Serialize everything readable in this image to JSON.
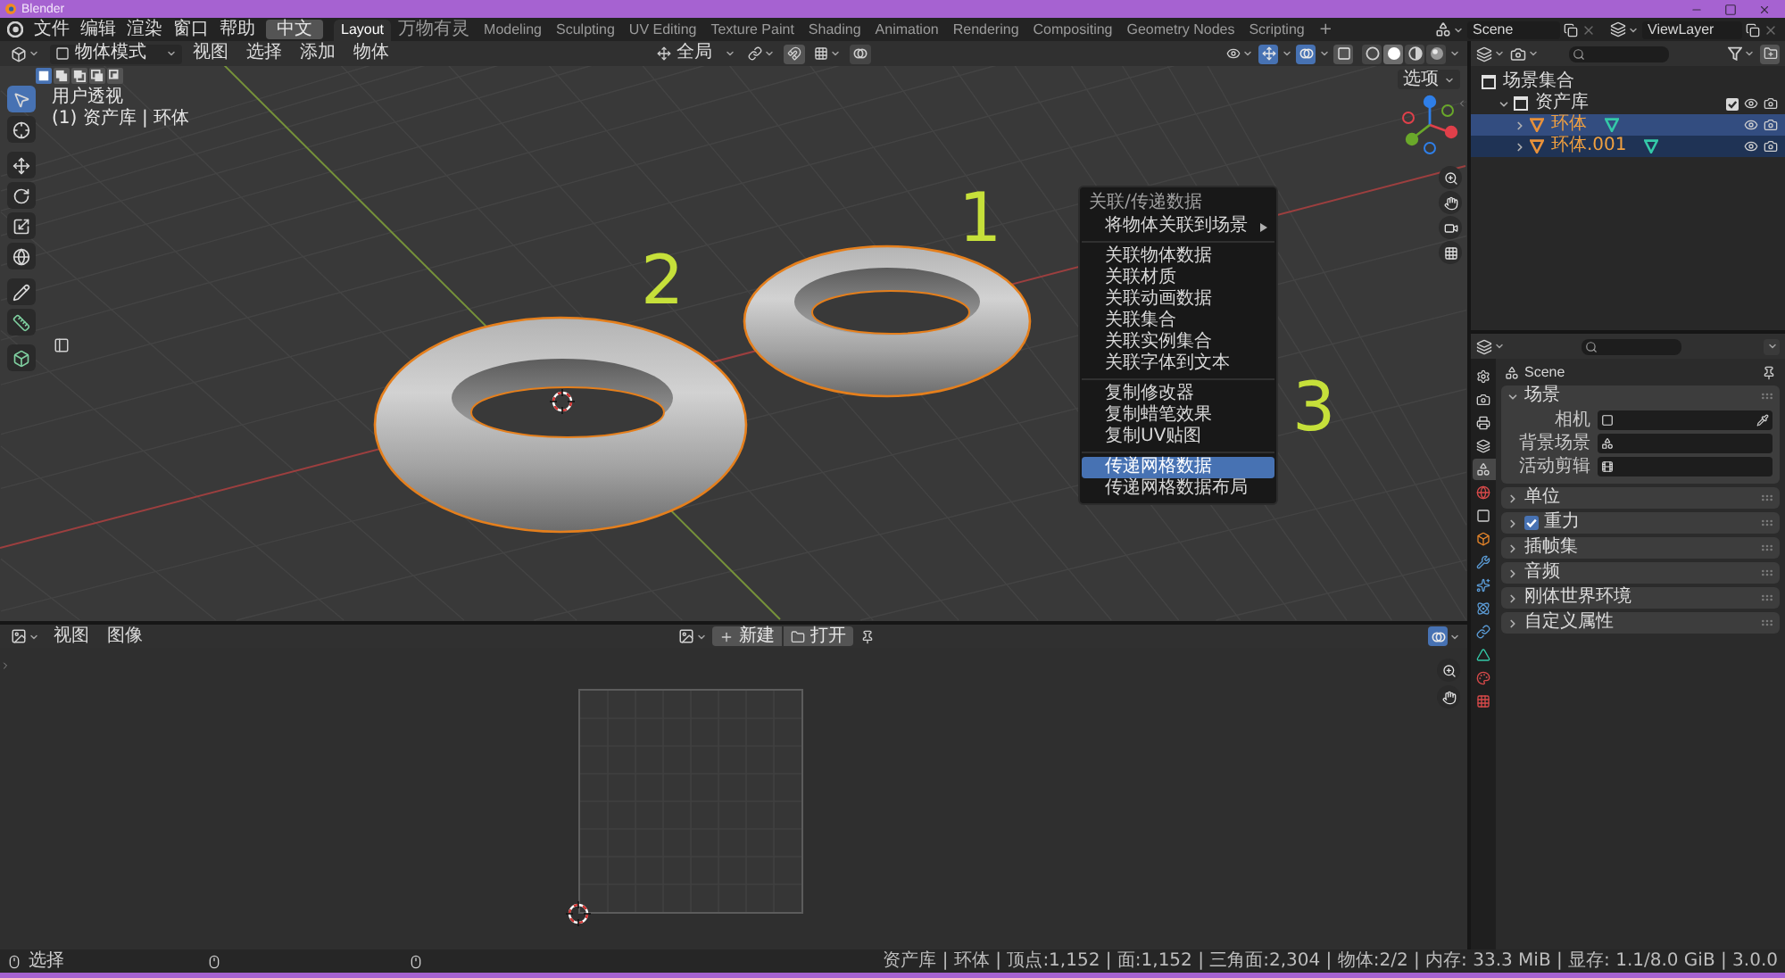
{
  "window": {
    "title": "Blender"
  },
  "top_bar": {
    "menus": [
      "文件",
      "编辑",
      "渲染",
      "窗口",
      "帮助"
    ],
    "language_button": "中文",
    "workspaces": [
      {
        "label": "Layout",
        "selected": true
      },
      {
        "label": "万物有灵",
        "selected": false
      },
      {
        "label": "Modeling",
        "selected": false
      },
      {
        "label": "Sculpting",
        "selected": false
      },
      {
        "label": "UV Editing",
        "selected": false
      },
      {
        "label": "Texture Paint",
        "selected": false
      },
      {
        "label": "Shading",
        "selected": false
      },
      {
        "label": "Animation",
        "selected": false
      },
      {
        "label": "Rendering",
        "selected": false
      },
      {
        "label": "Compositing",
        "selected": false
      },
      {
        "label": "Geometry Nodes",
        "selected": false
      },
      {
        "label": "Scripting",
        "selected": false
      }
    ],
    "add_workspace": "+",
    "scene": "Scene",
    "view_layer": "ViewLayer"
  },
  "viewport": {
    "mode": "物体模式",
    "menus": [
      "视图",
      "选择",
      "添加",
      "物体"
    ],
    "orientation": "全局",
    "options": "选项",
    "select_modes": [
      {
        "selected": true
      },
      {
        "selected": false
      },
      {
        "selected": false
      },
      {
        "selected": false
      },
      {
        "selected": false
      }
    ],
    "header_toggles": [
      {
        "on": true
      },
      {
        "on": true
      },
      {
        "on": false
      }
    ],
    "shading_modes": [
      {
        "selected": false
      },
      {
        "selected": true
      },
      {
        "selected": false
      },
      {
        "selected": false
      }
    ],
    "view_name": "用户透视",
    "context_info": "(1) 资产库 | 环体",
    "tools": [
      {
        "selected": true
      },
      {
        "selected": false
      },
      {
        "selected": false
      },
      {
        "selected": false
      },
      {
        "selected": false
      },
      {
        "selected": false
      },
      {
        "selected": false
      },
      {
        "selected": false
      },
      {
        "selected": false
      }
    ],
    "annotations": [
      {
        "text": "1"
      },
      {
        "text": "2"
      },
      {
        "text": "3"
      }
    ]
  },
  "context_menu": {
    "title": "关联/传递数据",
    "groups": [
      [
        {
          "label": "将物体关联到场景",
          "submenu": true,
          "selected": false
        }
      ],
      [
        {
          "label": "关联物体数据",
          "submenu": false,
          "selected": false
        },
        {
          "label": "关联材质",
          "submenu": false,
          "selected": false
        },
        {
          "label": "关联动画数据",
          "submenu": false,
          "selected": false
        },
        {
          "label": "关联集合",
          "submenu": false,
          "selected": false
        },
        {
          "label": "关联实例集合",
          "submenu": false,
          "selected": false
        },
        {
          "label": "关联字体到文本",
          "submenu": false,
          "selected": false
        }
      ],
      [
        {
          "label": "复制修改器",
          "submenu": false,
          "selected": false
        },
        {
          "label": "复制蜡笔效果",
          "submenu": false,
          "selected": false
        },
        {
          "label": "复制UV贴图",
          "submenu": false,
          "selected": false
        }
      ],
      [
        {
          "label": "传递网格数据",
          "submenu": false,
          "selected": true
        },
        {
          "label": "传递网格数据布局",
          "submenu": false,
          "selected": false
        }
      ]
    ]
  },
  "outliner": {
    "items": [
      {
        "label": "场景集合",
        "kind": "scene_collection",
        "children": [
          {
            "label": "资产库",
            "kind": "collection",
            "expanded": true,
            "children": [
              {
                "label": "环体",
                "kind": "object",
                "expanded": false,
                "selected": true,
                "active": true
              },
              {
                "label": "环体.001",
                "kind": "object",
                "expanded": false,
                "selected": true,
                "active": false
              }
            ]
          }
        ]
      }
    ]
  },
  "properties": {
    "tabs": [
      {
        "selected": false
      },
      {
        "selected": false
      },
      {
        "selected": false
      },
      {
        "selected": false
      },
      {
        "selected": true
      },
      {
        "selected": false
      },
      {
        "selected": false
      },
      {
        "selected": false
      },
      {
        "selected": false
      },
      {
        "selected": false
      },
      {
        "selected": false
      },
      {
        "selected": false
      },
      {
        "selected": false
      },
      {
        "selected": false
      },
      {
        "selected": false
      }
    ],
    "context": "Scene",
    "panels": [
      {
        "title": "场景",
        "kind": "plain",
        "expanded": true,
        "fields": [
          {
            "label": "相机"
          },
          {
            "label": "背景场景"
          },
          {
            "label": "活动剪辑"
          }
        ]
      },
      {
        "title": "单位",
        "kind": "plain",
        "expanded": false
      },
      {
        "title": "重力",
        "kind": "checkbox",
        "checked": true,
        "expanded": false
      },
      {
        "title": "插帧集",
        "kind": "plain",
        "expanded": false
      },
      {
        "title": "音频",
        "kind": "plain",
        "expanded": false
      },
      {
        "title": "刚体世界环境",
        "kind": "plain",
        "expanded": false
      },
      {
        "title": "自定义属性",
        "kind": "plain",
        "expanded": false
      }
    ]
  },
  "image_editor": {
    "menus": [
      "视图",
      "图像"
    ],
    "new_button": "新建",
    "open_button": "打开",
    "overlays_on": true
  },
  "status_bar": {
    "hint": "选择",
    "stats": "资产库 | 环体 | 顶点:1,152 | 面:1,152 | 三角面:2,304 | 物体:2/2 | 内存: 33.3 MiB | 显存: 1.1/8.0 GiB | 3.0.0"
  }
}
